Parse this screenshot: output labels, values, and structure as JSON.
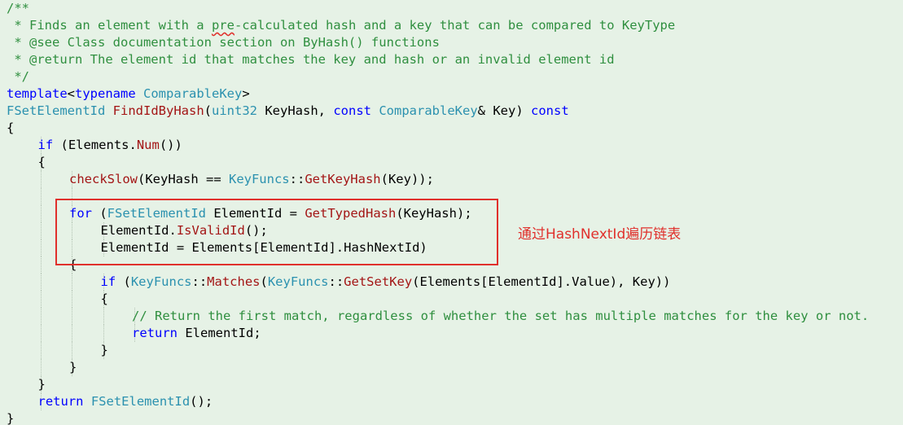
{
  "editor": {
    "lines": [
      {
        "indent": 0,
        "tokens": [
          {
            "t": "/**",
            "k": "comment"
          }
        ]
      },
      {
        "indent": 0,
        "tokens": [
          {
            "t": " * Finds an element with a ",
            "k": "comment"
          },
          {
            "t": "pre",
            "k": "comment",
            "squiggle": true
          },
          {
            "t": "-calculated hash and a key that can be compared to KeyType",
            "k": "comment"
          }
        ]
      },
      {
        "indent": 0,
        "tokens": [
          {
            "t": " * @see Class documentation section on ByHash() functions",
            "k": "comment"
          }
        ]
      },
      {
        "indent": 0,
        "tokens": [
          {
            "t": " * @return The element id that matches the key and hash or an invalid element id",
            "k": "comment"
          }
        ]
      },
      {
        "indent": 0,
        "tokens": [
          {
            "t": " */",
            "k": "comment"
          }
        ]
      },
      {
        "indent": 0,
        "tokens": [
          {
            "t": "template",
            "k": "keyword"
          },
          {
            "t": "<",
            "k": "text"
          },
          {
            "t": "typename",
            "k": "keyword"
          },
          {
            "t": " ",
            "k": "text"
          },
          {
            "t": "ComparableKey",
            "k": "type"
          },
          {
            "t": ">",
            "k": "text"
          }
        ]
      },
      {
        "indent": 0,
        "tokens": [
          {
            "t": "FSetElementId",
            "k": "type"
          },
          {
            "t": " ",
            "k": "text"
          },
          {
            "t": "FindIdByHash",
            "k": "func"
          },
          {
            "t": "(",
            "k": "text"
          },
          {
            "t": "uint32",
            "k": "type"
          },
          {
            "t": " KeyHash, ",
            "k": "text"
          },
          {
            "t": "const",
            "k": "keyword"
          },
          {
            "t": " ",
            "k": "text"
          },
          {
            "t": "ComparableKey",
            "k": "type"
          },
          {
            "t": "& Key) ",
            "k": "text"
          },
          {
            "t": "const",
            "k": "keyword"
          }
        ]
      },
      {
        "indent": 0,
        "tokens": [
          {
            "t": "{",
            "k": "text"
          }
        ]
      },
      {
        "indent": 1,
        "tokens": [
          {
            "t": "if",
            "k": "keyword"
          },
          {
            "t": " (Elements.",
            "k": "text"
          },
          {
            "t": "Num",
            "k": "func"
          },
          {
            "t": "())",
            "k": "text"
          }
        ]
      },
      {
        "indent": 1,
        "tokens": [
          {
            "t": "{",
            "k": "text"
          }
        ]
      },
      {
        "indent": 2,
        "tokens": [
          {
            "t": "checkSlow",
            "k": "func"
          },
          {
            "t": "(KeyHash == ",
            "k": "text"
          },
          {
            "t": "KeyFuncs",
            "k": "type"
          },
          {
            "t": "::",
            "k": "text"
          },
          {
            "t": "GetKeyHash",
            "k": "func"
          },
          {
            "t": "(Key));",
            "k": "text"
          }
        ]
      },
      {
        "indent": 2,
        "tokens": []
      },
      {
        "indent": 2,
        "tokens": [
          {
            "t": "for",
            "k": "keyword"
          },
          {
            "t": " (",
            "k": "text"
          },
          {
            "t": "FSetElementId",
            "k": "type"
          },
          {
            "t": " ElementId = ",
            "k": "text"
          },
          {
            "t": "GetTypedHash",
            "k": "func"
          },
          {
            "t": "(KeyHash);",
            "k": "text"
          }
        ]
      },
      {
        "indent": 3,
        "tokens": [
          {
            "t": "ElementId.",
            "k": "text"
          },
          {
            "t": "IsValidId",
            "k": "func"
          },
          {
            "t": "();",
            "k": "text"
          }
        ]
      },
      {
        "indent": 3,
        "tokens": [
          {
            "t": "ElementId = Elements[ElementId].HashNextId)",
            "k": "text"
          }
        ]
      },
      {
        "indent": 2,
        "tokens": [
          {
            "t": "{",
            "k": "text"
          }
        ]
      },
      {
        "indent": 3,
        "tokens": [
          {
            "t": "if",
            "k": "keyword"
          },
          {
            "t": " (",
            "k": "text"
          },
          {
            "t": "KeyFuncs",
            "k": "type"
          },
          {
            "t": "::",
            "k": "text"
          },
          {
            "t": "Matches",
            "k": "func"
          },
          {
            "t": "(",
            "k": "text"
          },
          {
            "t": "KeyFuncs",
            "k": "type"
          },
          {
            "t": "::",
            "k": "text"
          },
          {
            "t": "GetSetKey",
            "k": "func"
          },
          {
            "t": "(Elements[ElementId].Value), Key))",
            "k": "text"
          }
        ]
      },
      {
        "indent": 3,
        "tokens": [
          {
            "t": "{",
            "k": "text"
          }
        ]
      },
      {
        "indent": 4,
        "tokens": [
          {
            "t": "// Return the first match, regardless of whether the set has multiple matches for the key or not.",
            "k": "comment"
          }
        ]
      },
      {
        "indent": 4,
        "tokens": [
          {
            "t": "return",
            "k": "keyword"
          },
          {
            "t": " ElementId;",
            "k": "text"
          }
        ]
      },
      {
        "indent": 3,
        "tokens": [
          {
            "t": "}",
            "k": "text"
          }
        ]
      },
      {
        "indent": 2,
        "tokens": [
          {
            "t": "}",
            "k": "text"
          }
        ]
      },
      {
        "indent": 1,
        "tokens": [
          {
            "t": "}",
            "k": "text"
          }
        ]
      },
      {
        "indent": 1,
        "tokens": [
          {
            "t": "return",
            "k": "keyword"
          },
          {
            "t": " ",
            "k": "text"
          },
          {
            "t": "FSetElementId",
            "k": "type"
          },
          {
            "t": "();",
            "k": "text"
          }
        ]
      },
      {
        "indent": 0,
        "tokens": [
          {
            "t": "}",
            "k": "text"
          }
        ]
      }
    ]
  },
  "annotation": {
    "text": "通过HashNextId遍历链表"
  },
  "colors": {
    "background": "#e6f2e6",
    "comment": "#2f8f3f",
    "keyword": "#0000ff",
    "type": "#2b91af",
    "function": "#a31515",
    "annotation": "#e0302c"
  }
}
